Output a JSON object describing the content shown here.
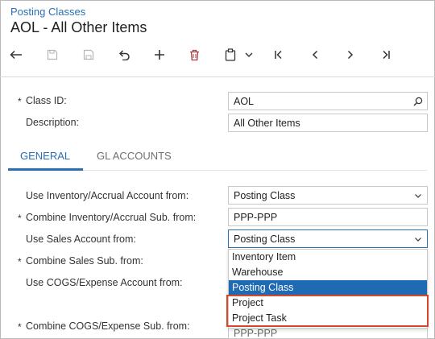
{
  "header": {
    "breadcrumb": "Posting Classes",
    "title": "AOL - All Other Items"
  },
  "toolbar": {
    "icons": [
      "back-arrow-icon",
      "save-close-icon",
      "save-icon",
      "undo-icon",
      "plus-icon",
      "trash-icon",
      "clipboard-icon",
      "chevron-down-icon",
      "first-record-icon",
      "prev-record-icon",
      "next-record-icon",
      "last-record-icon"
    ]
  },
  "summary": {
    "class_id_label": "Class ID:",
    "class_id_value": "AOL",
    "description_label": "Description:",
    "description_value": "All Other Items",
    "required_mark": "*"
  },
  "tabs": [
    {
      "label": "GENERAL"
    },
    {
      "label": "GL ACCOUNTS"
    }
  ],
  "general": {
    "inv_accrual_label": "Use Inventory/Accrual Account from:",
    "inv_accrual_value": "Posting Class",
    "combine_inv_label": "Combine Inventory/Accrual Sub. from:",
    "combine_inv_value": "PPP-PPP",
    "sales_account_label": "Use Sales Account from:",
    "sales_account_value": "Posting Class",
    "combine_sales_label": "Combine Sales Sub. from:",
    "cogs_label": "Use COGS/Expense Account from:",
    "combine_cogs_label": "Combine COGS/Expense Sub. from:",
    "combine_cogs_value_partial": "PPP-PPP"
  },
  "dropdown": {
    "options": [
      "Inventory Item",
      "Warehouse",
      "Posting Class",
      "Project",
      "Project Task"
    ],
    "selected": "Posting Class"
  },
  "colors": {
    "accent": "#2a6fb3",
    "highlight": "#1f6bb3",
    "callout": "#d9472b"
  }
}
